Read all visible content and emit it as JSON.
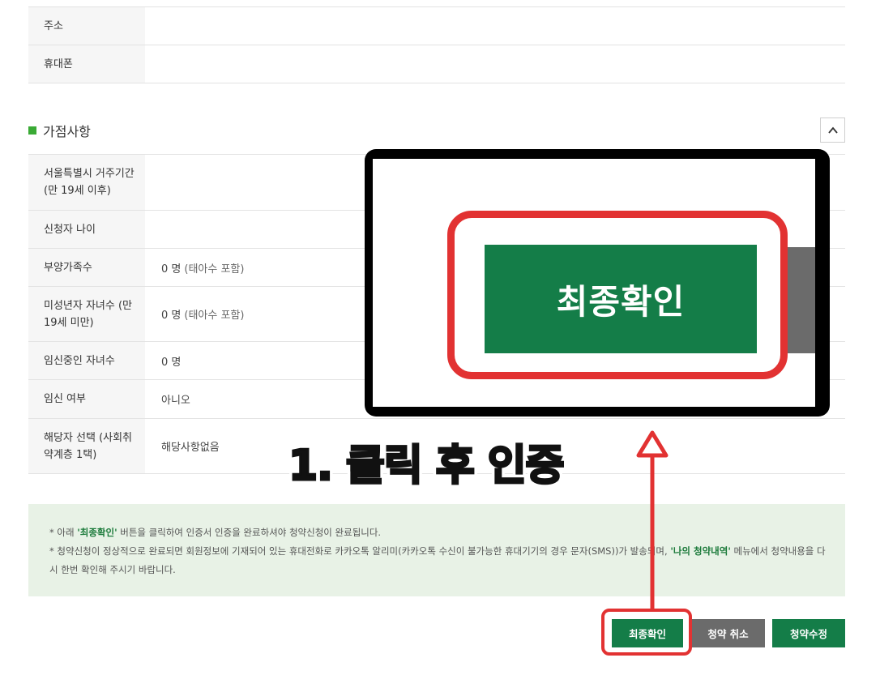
{
  "top_table": {
    "rows": [
      {
        "label": "주소",
        "value": ""
      },
      {
        "label": "휴대폰",
        "value": ""
      }
    ]
  },
  "additional": {
    "title": "가점사항",
    "rows": [
      {
        "label": "서울특별시 거주기간 (만 19세 이후)",
        "value": "",
        "note": ""
      },
      {
        "label": "신청자 나이",
        "value": "",
        "note": ""
      },
      {
        "label": "부양가족수",
        "value": "0 명",
        "note": "(태아수 포함)"
      },
      {
        "label": "미성년자 자녀수 (만 19세 미만)",
        "value": "0 명",
        "note": "(태아수 포함)"
      },
      {
        "label": "임신중인 자녀수",
        "value": "0 명",
        "note": ""
      },
      {
        "label": "임신 여부",
        "value": "아니오",
        "note": ""
      },
      {
        "label": "해당자 선택 (사회취약계층 1택)",
        "value": "해당사항없음",
        "note": ""
      }
    ]
  },
  "notice": {
    "line1_pre": "* 아래 ",
    "line1_hl": "'최종확인'",
    "line1_post": " 버튼을 클릭하여 인증서 인증을 완료하셔야 청약신청이 완료됩니다.",
    "line2_pre": "* 청약신청이 정상적으로 완료되면 회원정보에 기재되어 있는 휴대전화로 카카오톡 알리미(카카오톡 수신이 불가능한 휴대기기의 경우 문자(SMS))가 발송되며, ",
    "line2_hl": "'나의 청약내역'",
    "line2_post": " 메뉴에서 청약내용을 다시 한번 확인해 주시기 바랍니다."
  },
  "buttons": {
    "final": "최종확인",
    "cancel": "청약 취소",
    "edit": "청약수정"
  },
  "annotation": {
    "zoom_label": "최종확인",
    "step_text": "1. 클릭 후 인증",
    "accent_red": "#e23232",
    "accent_green": "#147d48"
  }
}
